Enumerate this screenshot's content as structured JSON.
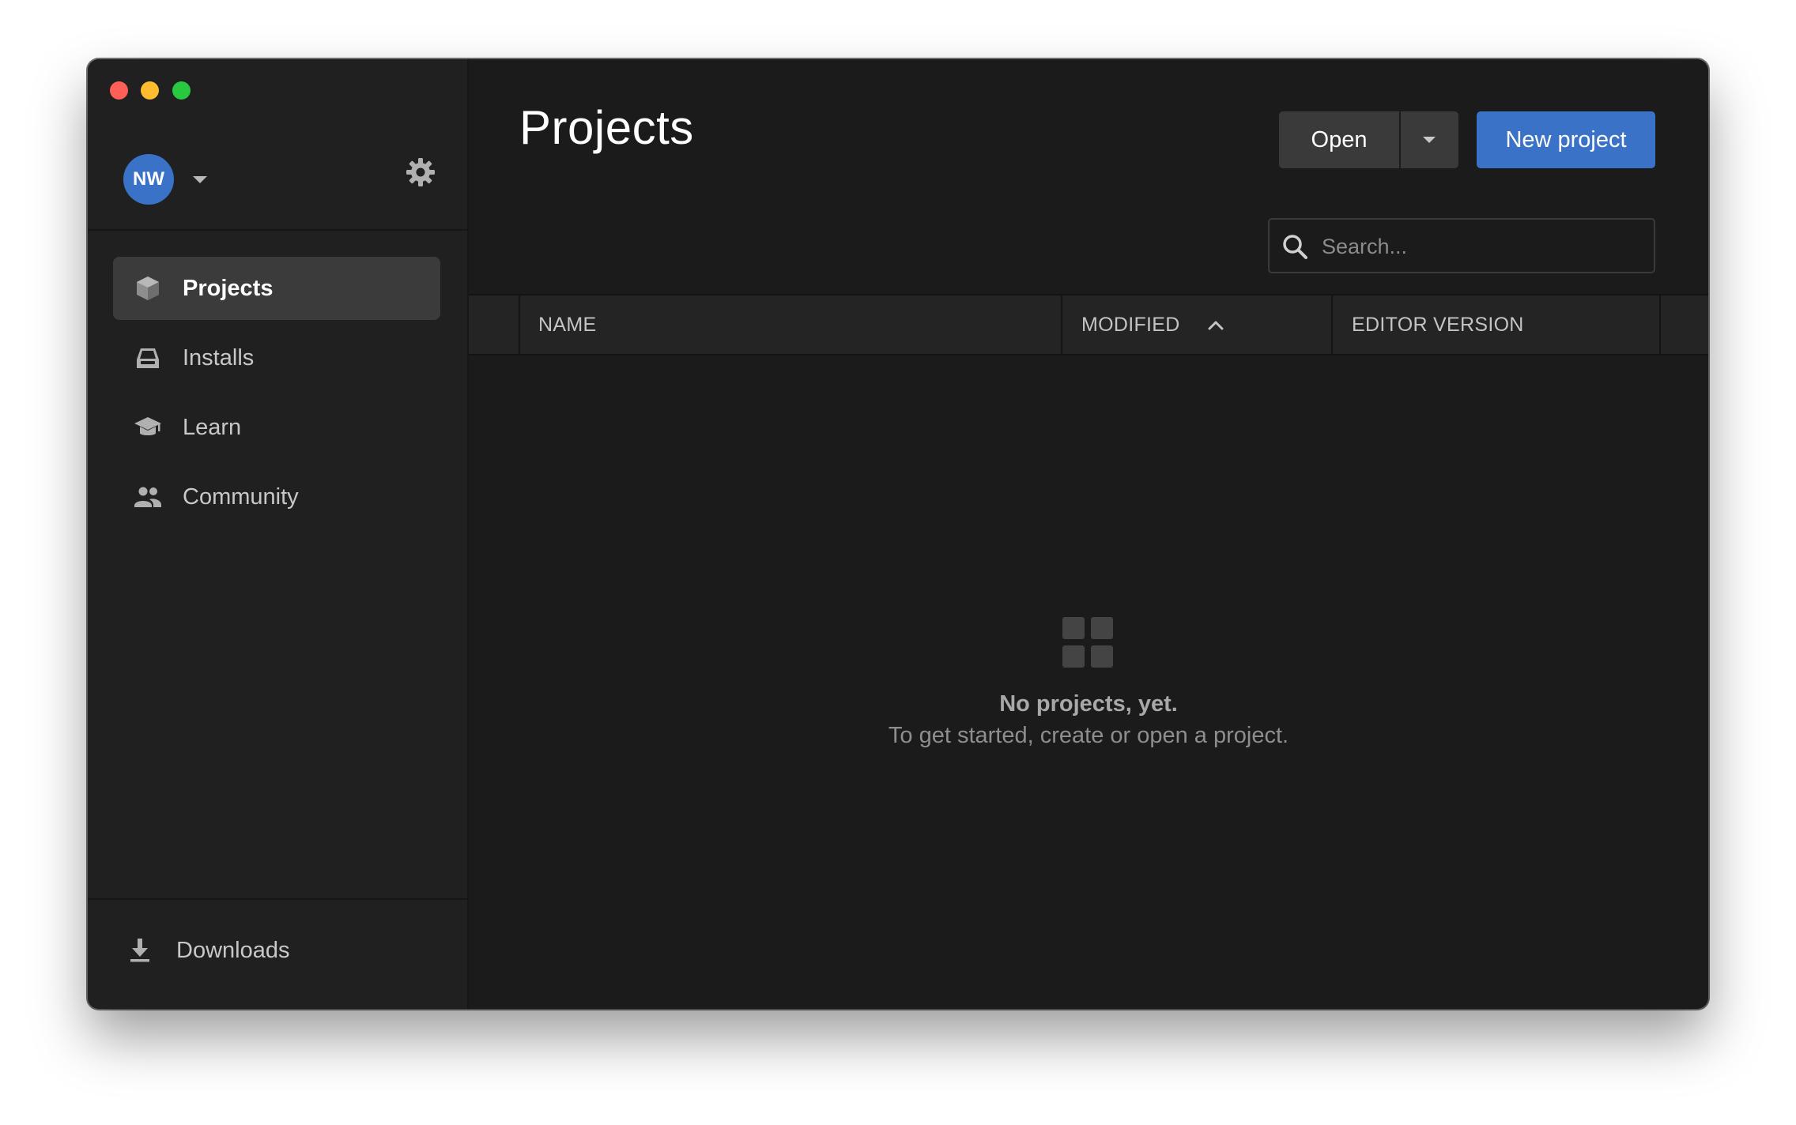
{
  "window": {
    "title": "Projects"
  },
  "account": {
    "initials": "NW",
    "avatar_color": "#3a72c8"
  },
  "sidebar": {
    "items": [
      {
        "label": "Projects",
        "icon": "cube-icon",
        "active": true
      },
      {
        "label": "Installs",
        "icon": "drive-icon",
        "active": false
      },
      {
        "label": "Learn",
        "icon": "graduation-cap-icon",
        "active": false
      },
      {
        "label": "Community",
        "icon": "people-icon",
        "active": false
      }
    ],
    "downloads_label": "Downloads"
  },
  "toolbar": {
    "open_label": "Open",
    "new_project_label": "New project",
    "accent_color": "#3a72c8"
  },
  "search": {
    "placeholder": "Search...",
    "value": ""
  },
  "table": {
    "columns": [
      "NAME",
      "MODIFIED",
      "EDITOR VERSION"
    ],
    "sorted_column": "MODIFIED",
    "sort_direction": "ascending",
    "rows": []
  },
  "empty_state": {
    "title": "No projects, yet.",
    "subtitle": "To get started, create or open a project."
  }
}
